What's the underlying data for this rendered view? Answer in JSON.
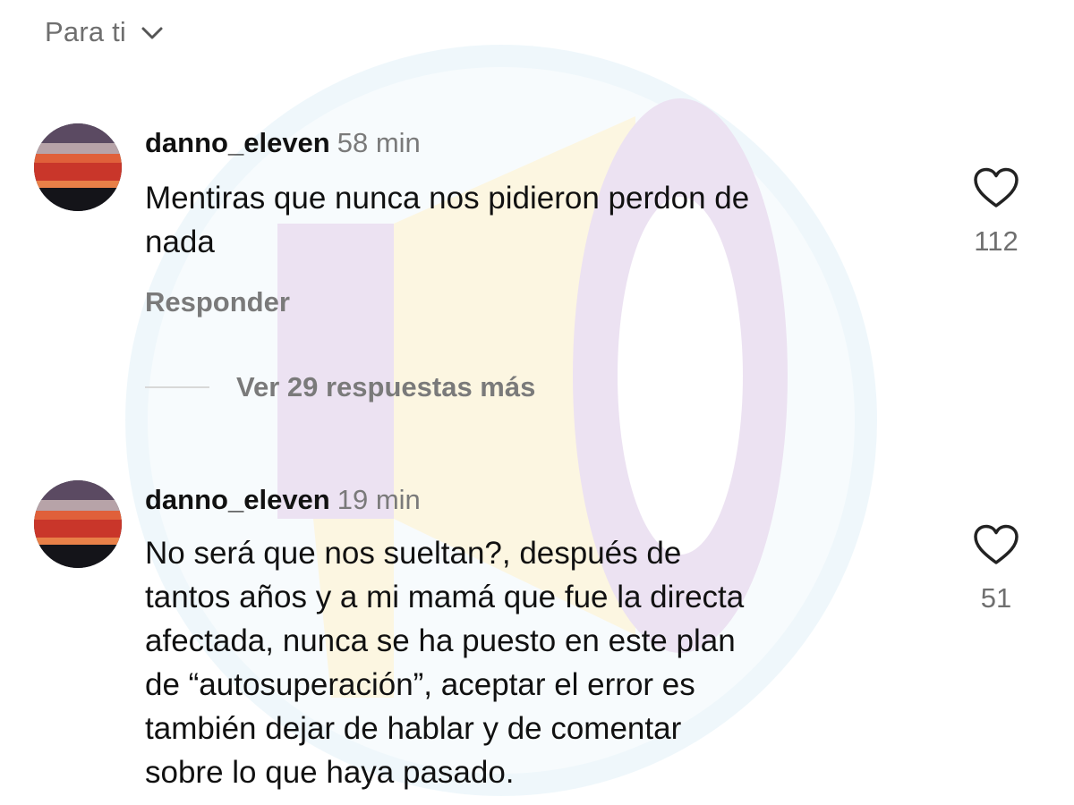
{
  "header": {
    "feed_label": "Para ti",
    "dropdown_icon": "chevron-down-icon"
  },
  "comments": [
    {
      "username": "danno_eleven",
      "time": "58 min",
      "text": "Mentiras que nunca nos pidieron perdon de\nnada",
      "reply_label": "Responder",
      "likes": "112",
      "like_icon": "heart-outline-icon"
    },
    {
      "username": "danno_eleven",
      "time": "19 min",
      "text": "No será que nos sueltan?, después de\ntantos años y a mi mamá que fue la directa\nafectada, nunca se ha puesto en este plan\nde “autosuperación”, aceptar el error es\ntambién dejar de hablar y de comentar\nsobre lo que haya pasado.",
      "likes": "51",
      "like_icon": "heart-outline-icon"
    }
  ],
  "thread": {
    "view_more_label": "Ver 29 respuestas más"
  },
  "colors": {
    "text": "#111111",
    "muted": "#7a7a7a",
    "watermark_purple": "#8e4fb0",
    "watermark_yellow": "#f2c94c",
    "watermark_blue": "#9fd3ea"
  }
}
